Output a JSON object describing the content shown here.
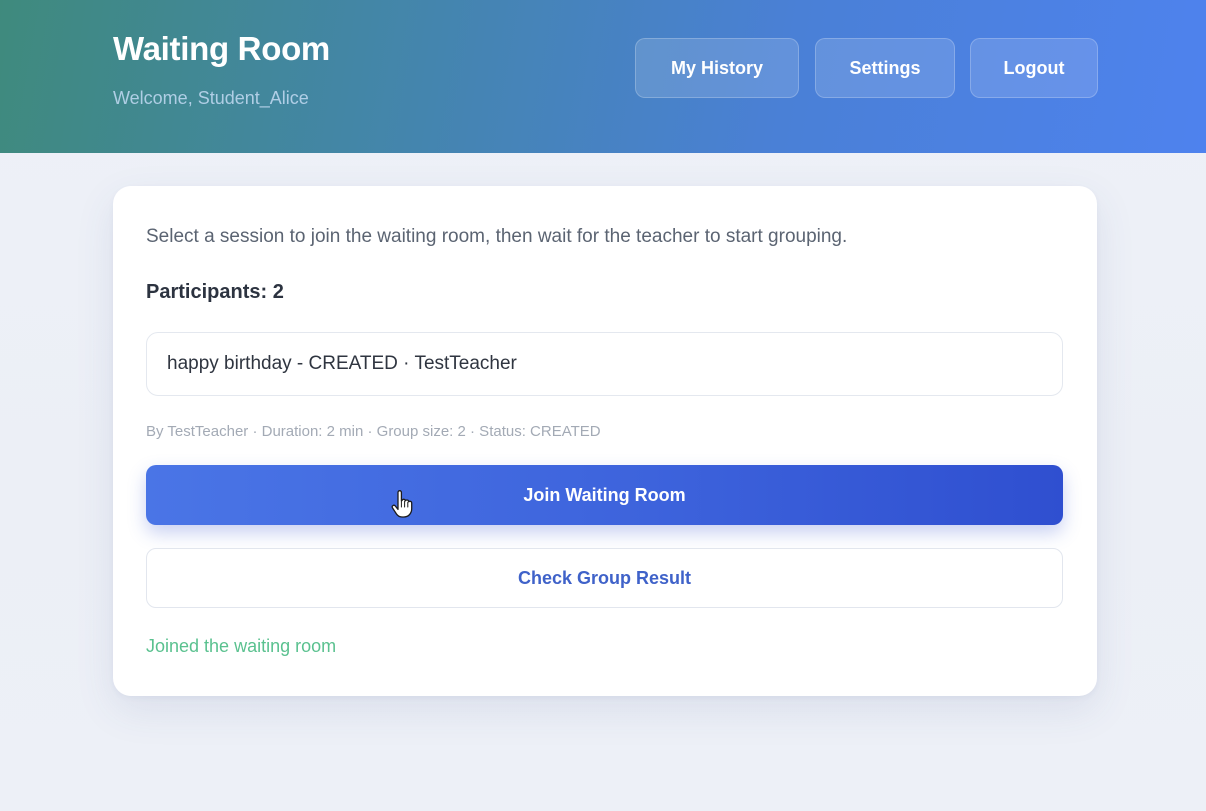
{
  "header": {
    "title": "Waiting Room",
    "subtitle": "Welcome, Student_Alice",
    "nav": {
      "history": "My History",
      "settings": "Settings",
      "logout": "Logout"
    }
  },
  "card": {
    "intro": "Select a session to join the waiting room, then wait for the teacher to start grouping.",
    "participants": "Participants: 2",
    "session_select": {
      "value": "happy birthday - CREATED · TestTeacher"
    },
    "meta": "By TestTeacher · Duration: 2 min · Group size: 2 · Status: CREATED",
    "join_button": "Join Waiting Room",
    "check_button": "Check Group Result",
    "status_message": "Joined the waiting room"
  },
  "colors": {
    "header_start": "#3f8a7d",
    "header_end": "#4e82ee",
    "primary": "#3d63dc",
    "link": "#3f62c9",
    "success": "#5ac18f"
  },
  "icons": {
    "cursor": "hand-pointer-icon"
  }
}
